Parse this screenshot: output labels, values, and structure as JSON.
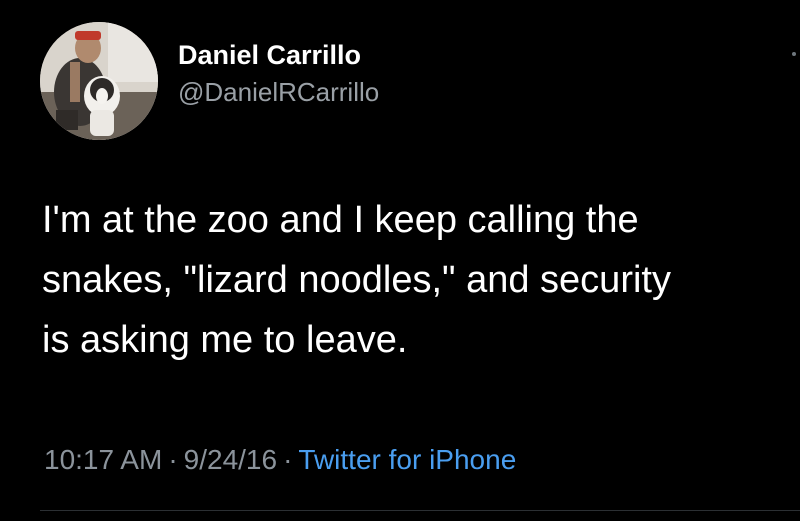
{
  "user": {
    "display_name": "Daniel Carrillo",
    "handle": "@DanielRCarrillo",
    "avatar_icon": "profile-photo-man-with-dog"
  },
  "tweet": {
    "text": "I'm at the zoo and I keep calling the\nsnakes, \"lizard noodles,\" and security\nis asking me to leave."
  },
  "meta": {
    "time": "10:17 AM",
    "separator": "·",
    "date": "9/24/16",
    "source": "Twitter for iPhone"
  },
  "colors": {
    "background": "#000000",
    "text": "#ffffff",
    "secondary_text": "#8b939b",
    "link": "#4a9ef0"
  }
}
